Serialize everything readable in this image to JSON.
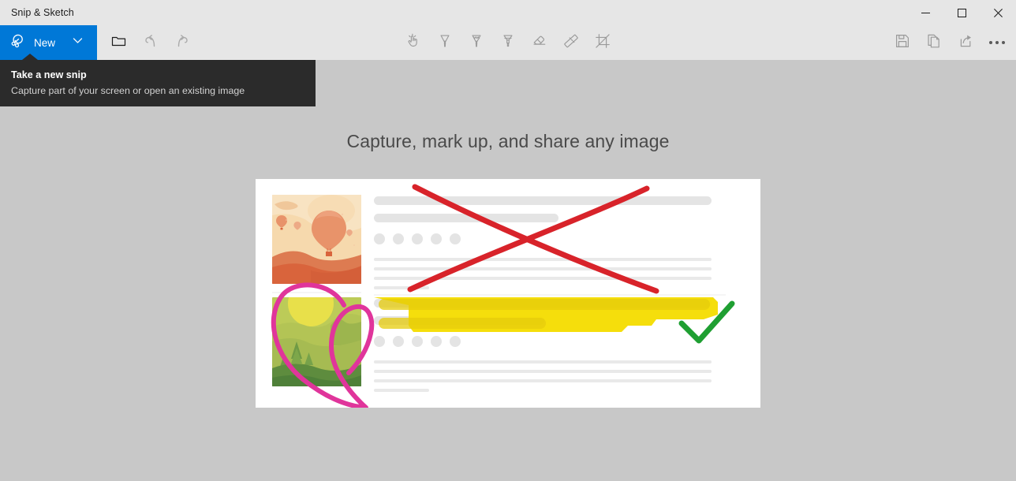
{
  "window": {
    "title": "Snip & Sketch",
    "controls": [
      {
        "name": "minimize-button",
        "glyph": "minimize"
      },
      {
        "name": "maximize-button",
        "glyph": "maximize"
      },
      {
        "name": "close-button",
        "glyph": "close"
      }
    ]
  },
  "toolbar": {
    "new_label": "New",
    "new_icon": "snip-scissors-icon",
    "new_dropdown_icon": "chevron-down-icon",
    "open_label": "Open file",
    "open_icon": "folder-icon",
    "undo_label": "Undo",
    "undo_icon": "undo-icon",
    "undo_disabled": true,
    "redo_label": "Redo",
    "redo_icon": "redo-icon",
    "redo_disabled": true,
    "tools": [
      {
        "name": "touch-writing-tool",
        "label": "Touch writing",
        "icon": "hand-pointer-icon"
      },
      {
        "name": "ballpoint-pen-tool",
        "label": "Ballpoint pen",
        "icon": "pen-icon"
      },
      {
        "name": "pencil-tool",
        "label": "Pencil",
        "icon": "pencil-icon"
      },
      {
        "name": "highlighter-tool",
        "label": "Highlighter",
        "icon": "highlighter-icon"
      },
      {
        "name": "eraser-tool",
        "label": "Eraser",
        "icon": "eraser-icon"
      },
      {
        "name": "ruler-tool",
        "label": "Ruler",
        "icon": "ruler-icon"
      },
      {
        "name": "crop-tool",
        "label": "Image crop",
        "icon": "crop-icon"
      }
    ],
    "actions": [
      {
        "name": "save-button",
        "label": "Save as",
        "icon": "save-floppy-icon"
      },
      {
        "name": "copy-button",
        "label": "Copy",
        "icon": "copy-pages-icon"
      },
      {
        "name": "share-button",
        "label": "Share",
        "icon": "share-arrow-icon"
      },
      {
        "name": "more-button",
        "label": "See more",
        "icon": "ellipsis-icon"
      }
    ]
  },
  "tooltip": {
    "title": "Take a new snip",
    "subtitle": "Capture part of your screen or open an existing image"
  },
  "main": {
    "headline": "Capture, mark up, and share any image",
    "illustration": {
      "name": "markup-sample-illustration",
      "card_background": "#ffffff",
      "thumb_top": {
        "name": "desert-balloon-thumbnail",
        "palette": [
          "#f5c98f",
          "#f7d9ab",
          "#e8936a",
          "#d9643c",
          "#c9502f"
        ]
      },
      "thumb_bottom": {
        "name": "green-forest-thumbnail",
        "palette": [
          "#c3cf56",
          "#e8e04a",
          "#9cb54e",
          "#6f9a45",
          "#4f8039"
        ]
      },
      "placeholder_color": "#e4e4e4",
      "line_color": "#e8e8e8",
      "annotations": [
        {
          "name": "red-cross-out-annotation",
          "color": "#d8232a",
          "tool": "ballpoint-pen"
        },
        {
          "name": "pink-heart-annotation",
          "color": "#e0359b",
          "tool": "ballpoint-pen"
        },
        {
          "name": "yellow-highlight-annotation",
          "color": "#f5dd00",
          "tool": "highlighter"
        },
        {
          "name": "green-check-annotation",
          "color": "#1f9f32",
          "tool": "ballpoint-pen"
        }
      ]
    }
  },
  "colors": {
    "accent": "#0078d7",
    "titlebar": "#e6e6e6",
    "canvas_background": "#c8c8c8",
    "tooltip_background": "#2b2b2b"
  }
}
